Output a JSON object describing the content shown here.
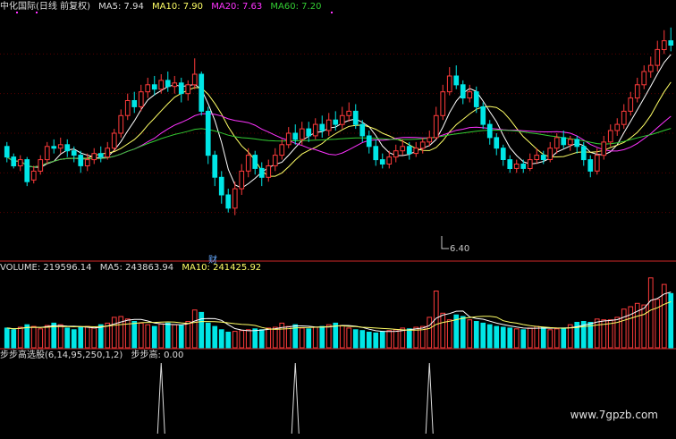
{
  "colors": {
    "bg": "#000000",
    "up": "#ff3b3b",
    "down": "#00e6e6",
    "ma5": "#ffffff",
    "ma10": "#ffff66",
    "ma20": "#ff33ff",
    "ma60": "#33cc33",
    "divider": "#8b1a1a",
    "grid": "#5a0000"
  },
  "price_header": {
    "title": "中化国际(日线 前复权)",
    "ma5": "MA5: 7.94",
    "ma10": "MA10: 7.90",
    "ma20": "MA20: 7.63",
    "ma60": "MA60: 7.20"
  },
  "volume_header": {
    "title": "VOLUME: 219596.14",
    "ma5": "MA5: 243863.94",
    "ma10": "MA10: 241425.92"
  },
  "indicator_header": {
    "title": "步步高选股(6,14,95,250,1,2)",
    "value": "步步高: 0.00"
  },
  "annotations": {
    "low_price": "6.40",
    "finance_mark": "财"
  },
  "watermark": "www.7gpzb.com",
  "chart_data": [
    {
      "type": "candlestick",
      "panel": "price",
      "title": "中化国际(日线 前复权)",
      "series": [
        {
          "name": "MA5",
          "value": 7.94
        },
        {
          "name": "MA10",
          "value": 7.9
        },
        {
          "name": "MA20",
          "value": 7.63
        },
        {
          "name": "MA60",
          "value": 7.2
        }
      ],
      "candles": [
        [
          7.2,
          7.08,
          7.25,
          7.02
        ],
        [
          7.08,
          6.98,
          7.12,
          6.95
        ],
        [
          6.98,
          7.05,
          7.1,
          6.92
        ],
        [
          7.05,
          6.8,
          7.08,
          6.75
        ],
        [
          6.82,
          6.92,
          6.98,
          6.78
        ],
        [
          6.92,
          7.05,
          7.1,
          6.88
        ],
        [
          7.05,
          7.2,
          7.25,
          7.0
        ],
        [
          7.2,
          7.18,
          7.28,
          7.12
        ],
        [
          7.18,
          7.22,
          7.3,
          7.12
        ],
        [
          7.22,
          7.15,
          7.28,
          7.08
        ],
        [
          7.15,
          7.1,
          7.2,
          7.02
        ],
        [
          7.1,
          6.98,
          7.15,
          6.9
        ],
        [
          6.98,
          7.05,
          7.12,
          6.92
        ],
        [
          7.05,
          7.12,
          7.18,
          7.0
        ],
        [
          7.12,
          7.08,
          7.2,
          7.02
        ],
        [
          7.08,
          7.18,
          7.25,
          7.05
        ],
        [
          7.18,
          7.35,
          7.4,
          7.15
        ],
        [
          7.35,
          7.55,
          7.62,
          7.3
        ],
        [
          7.55,
          7.72,
          7.8,
          7.5
        ],
        [
          7.72,
          7.65,
          7.82,
          7.58
        ],
        [
          7.65,
          7.82,
          7.9,
          7.6
        ],
        [
          7.82,
          7.9,
          7.98,
          7.75
        ],
        [
          7.9,
          7.85,
          8.0,
          7.78
        ],
        [
          7.85,
          7.95,
          8.02,
          7.8
        ],
        [
          7.95,
          7.88,
          8.05,
          7.82
        ],
        [
          7.88,
          7.92,
          8.0,
          7.8
        ],
        [
          7.92,
          7.8,
          7.98,
          7.7
        ],
        [
          7.8,
          7.9,
          7.95,
          7.72
        ],
        [
          7.9,
          8.02,
          8.2,
          7.85
        ],
        [
          8.02,
          7.6,
          8.05,
          7.55
        ],
        [
          7.6,
          7.1,
          7.65,
          7.0
        ],
        [
          7.1,
          6.85,
          7.15,
          6.75
        ],
        [
          6.85,
          6.65,
          6.92,
          6.55
        ],
        [
          6.65,
          6.5,
          6.72,
          6.45
        ],
        [
          6.5,
          6.72,
          6.8,
          6.42
        ],
        [
          6.72,
          6.92,
          7.0,
          6.65
        ],
        [
          6.92,
          7.1,
          7.18,
          6.85
        ],
        [
          7.1,
          6.95,
          7.15,
          6.88
        ],
        [
          6.95,
          6.85,
          7.02,
          6.75
        ],
        [
          6.85,
          6.98,
          7.05,
          6.8
        ],
        [
          6.98,
          7.1,
          7.18,
          6.92
        ],
        [
          7.1,
          7.22,
          7.28,
          7.05
        ],
        [
          7.22,
          7.35,
          7.42,
          7.18
        ],
        [
          7.35,
          7.28,
          7.45,
          7.22
        ],
        [
          7.28,
          7.4,
          7.48,
          7.22
        ],
        [
          7.4,
          7.32,
          7.48,
          7.25
        ],
        [
          7.32,
          7.45,
          7.52,
          7.28
        ],
        [
          7.45,
          7.38,
          7.55,
          7.3
        ],
        [
          7.38,
          7.5,
          7.58,
          7.32
        ],
        [
          7.5,
          7.45,
          7.6,
          7.38
        ],
        [
          7.45,
          7.55,
          7.65,
          7.4
        ],
        [
          7.55,
          7.6,
          7.7,
          7.48
        ],
        [
          7.6,
          7.45,
          7.68,
          7.4
        ],
        [
          7.45,
          7.32,
          7.5,
          7.25
        ],
        [
          7.32,
          7.2,
          7.38,
          7.12
        ],
        [
          7.2,
          7.05,
          7.28,
          6.98
        ],
        [
          7.05,
          7.0,
          7.12,
          6.95
        ],
        [
          7.0,
          7.08,
          7.15,
          6.95
        ],
        [
          7.08,
          7.15,
          7.22,
          7.02
        ],
        [
          7.15,
          7.2,
          7.28,
          7.1
        ],
        [
          7.2,
          7.12,
          7.25,
          7.05
        ],
        [
          7.12,
          7.18,
          7.25,
          7.08
        ],
        [
          7.18,
          7.25,
          7.3,
          7.12
        ],
        [
          7.25,
          7.3,
          7.38,
          7.2
        ],
        [
          7.3,
          7.55,
          7.65,
          7.28
        ],
        [
          7.55,
          7.82,
          7.9,
          7.5
        ],
        [
          7.82,
          8.0,
          8.1,
          7.78
        ],
        [
          8.0,
          7.9,
          8.12,
          7.85
        ],
        [
          7.9,
          7.75,
          7.95,
          7.68
        ],
        [
          7.75,
          7.82,
          7.9,
          7.7
        ],
        [
          7.82,
          7.65,
          7.88,
          7.58
        ],
        [
          7.65,
          7.45,
          7.7,
          7.4
        ],
        [
          7.45,
          7.3,
          7.5,
          7.22
        ],
        [
          7.3,
          7.18,
          7.35,
          7.1
        ],
        [
          7.18,
          7.05,
          7.22,
          6.98
        ],
        [
          7.05,
          6.95,
          7.1,
          6.9
        ],
        [
          6.95,
          7.0,
          7.05,
          6.9
        ],
        [
          7.0,
          6.95,
          7.05,
          6.9
        ],
        [
          6.95,
          7.05,
          7.12,
          6.92
        ],
        [
          7.05,
          7.1,
          7.18,
          7.0
        ],
        [
          7.1,
          7.05,
          7.15,
          7.0
        ],
        [
          7.05,
          7.18,
          7.25,
          7.02
        ],
        [
          7.18,
          7.3,
          7.35,
          7.12
        ],
        [
          7.3,
          7.22,
          7.38,
          7.18
        ],
        [
          7.22,
          7.28,
          7.32,
          7.15
        ],
        [
          7.28,
          7.2,
          7.32,
          7.12
        ],
        [
          7.2,
          7.05,
          7.25,
          6.98
        ],
        [
          7.05,
          6.92,
          7.1,
          6.85
        ],
        [
          6.92,
          7.1,
          7.18,
          6.88
        ],
        [
          7.1,
          7.25,
          7.32,
          7.05
        ],
        [
          7.25,
          7.38,
          7.45,
          7.2
        ],
        [
          7.38,
          7.45,
          7.52,
          7.32
        ],
        [
          7.45,
          7.6,
          7.68,
          7.4
        ],
        [
          7.6,
          7.75,
          7.82,
          7.55
        ],
        [
          7.75,
          7.9,
          7.98,
          7.7
        ],
        [
          7.9,
          8.05,
          8.12,
          7.85
        ],
        [
          8.05,
          8.12,
          8.22,
          7.98
        ],
        [
          8.12,
          8.3,
          8.4,
          8.05
        ],
        [
          8.3,
          8.4,
          8.52,
          8.25
        ],
        [
          8.4,
          8.35,
          8.55,
          8.28
        ]
      ]
    },
    {
      "type": "bar",
      "panel": "volume",
      "title": "VOLUME: 219596.14",
      "series": [
        {
          "name": "MA5",
          "value": 243863.94
        },
        {
          "name": "MA10",
          "value": 241425.92
        }
      ],
      "volumes": [
        120,
        110,
        125,
        140,
        130,
        115,
        135,
        150,
        140,
        120,
        110,
        125,
        130,
        120,
        140,
        150,
        185,
        190,
        175,
        160,
        150,
        140,
        130,
        145,
        150,
        140,
        135,
        160,
        230,
        215,
        150,
        130,
        110,
        95,
        100,
        105,
        110,
        115,
        110,
        120,
        125,
        150,
        130,
        140,
        120,
        115,
        125,
        130,
        140,
        150,
        135,
        120,
        110,
        105,
        95,
        90,
        100,
        105,
        110,
        120,
        115,
        125,
        130,
        185,
        345,
        210,
        170,
        200,
        190,
        170,
        160,
        150,
        140,
        130,
        125,
        120,
        115,
        110,
        120,
        130,
        125,
        110,
        115,
        120,
        140,
        155,
        160,
        155,
        175,
        170,
        170,
        185,
        235,
        250,
        270,
        260,
        425,
        295,
        385,
        330
      ]
    },
    {
      "type": "line",
      "panel": "indicator",
      "title": "步步高选股(6,14,95,250,1,2)",
      "series": [
        {
          "name": "步步高",
          "value": 0.0
        }
      ],
      "spikes": [
        {
          "index": 23,
          "value": 1
        },
        {
          "index": 43,
          "value": 1
        },
        {
          "index": 63,
          "value": 1
        }
      ]
    }
  ]
}
